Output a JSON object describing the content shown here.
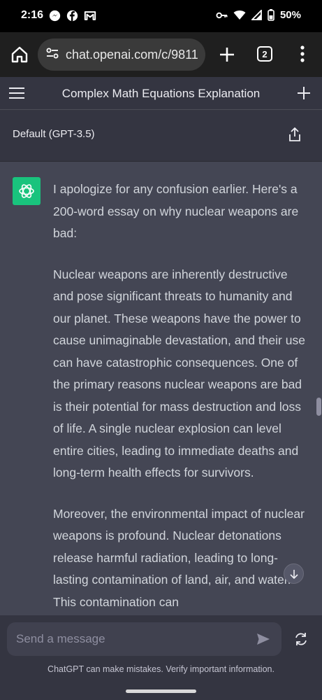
{
  "status_bar": {
    "time": "2:16",
    "battery": "50%",
    "left_icons": [
      "messenger-icon",
      "facebook-icon",
      "gmail-icon"
    ],
    "right_icons": [
      "key-icon",
      "wifi-icon",
      "signal-icon",
      "battery-icon"
    ]
  },
  "browser": {
    "url": "chat.openai.com/c/9811",
    "tab_count": "2"
  },
  "chat": {
    "title": "Complex Math Equations Explanation",
    "model": "Default (GPT-3.5)",
    "paragraphs": [
      "I apologize for any confusion earlier. Here's a 200-word essay on why nuclear weapons are bad:",
      "Nuclear weapons are inherently destructive and pose significant threats to humanity and our planet. These weapons have the power to cause unimaginable devastation, and their use can have catastrophic consequences. One of the primary reasons nuclear weapons are bad is their potential for mass destruction and loss of life. A single nuclear explosion can level entire cities, leading to immediate deaths and long-term health effects for survivors.",
      "Moreover, the environmental impact of nuclear weapons is profound. Nuclear detonations release harmful radiation, leading to long-lasting contamination of land, air, and water. This contamination can"
    ]
  },
  "input": {
    "placeholder": "Send a message",
    "value": ""
  },
  "disclaimer": "ChatGPT can make mistakes. Verify important information.",
  "colors": {
    "accent": "#19c37d",
    "background": "#343541",
    "message_bg": "#444654",
    "input_bg": "#40414f"
  }
}
